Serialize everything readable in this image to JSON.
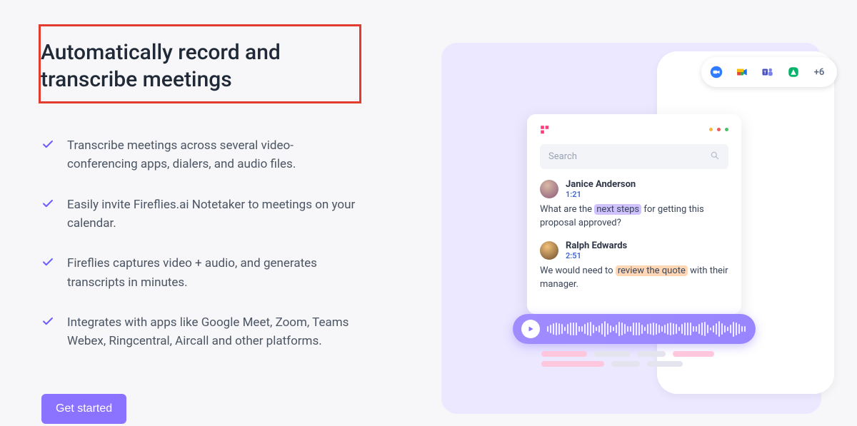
{
  "heading": "Automatically record and transcribe meetings",
  "features": [
    "Transcribe meetings across several video-conferencing apps, dialers, and audio files.",
    "Easily invite Fireflies.ai Notetaker to meetings on your calendar.",
    "Fireflies captures video + audio, and generates transcripts in minutes.",
    "Integrates with apps like Google Meet, Zoom, Teams Webex, Ringcentral, Aircall and other platforms."
  ],
  "cta_label": "Get started",
  "integrations": {
    "icons": [
      "zoom-icon",
      "google-meet-icon",
      "ms-teams-icon",
      "aircall-icon"
    ],
    "more_label": "+6"
  },
  "panel": {
    "search_placeholder": "Search",
    "traffic_colors": [
      "#f5b642",
      "#ee5a5a",
      "#4bbf6b"
    ],
    "messages": [
      {
        "name": "Janice Anderson",
        "timestamp": "1:21",
        "text_pre": "What are the ",
        "highlight": "next steps",
        "text_post": " for getting this proposal approved?"
      },
      {
        "name": "Ralph Edwards",
        "timestamp": "2:51",
        "text_pre": "We would need to ",
        "highlight": "review the quote",
        "text_post": " with their manager."
      }
    ]
  }
}
